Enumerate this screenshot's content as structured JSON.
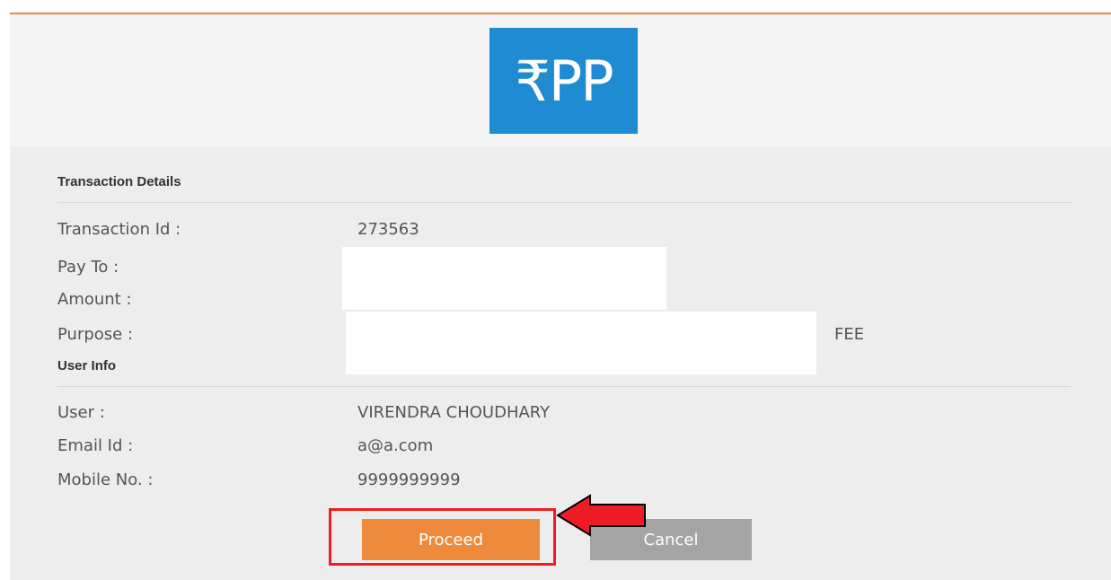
{
  "logo": {
    "text": "₹PP"
  },
  "transaction": {
    "title": "Transaction Details",
    "fields": [
      {
        "label": "Transaction Id :",
        "value": "273563"
      },
      {
        "label": "Pay To :",
        "value": ""
      },
      {
        "label": "Amount :",
        "value": ""
      },
      {
        "label": "Purpose :",
        "value": "FEE"
      }
    ]
  },
  "user_info": {
    "title": "User Info",
    "fields": [
      {
        "label": "User :",
        "value": "VIRENDRA CHOUDHARY"
      },
      {
        "label": "Email Id :",
        "value": "a@a.com"
      },
      {
        "label": "Mobile No. :",
        "value": "9999999999"
      }
    ]
  },
  "actions": {
    "proceed_label": "Proceed",
    "cancel_label": "Cancel"
  },
  "colors": {
    "accent": "#ee8a3c",
    "logo_bg": "#1e8bd2",
    "highlight": "#ee1c24",
    "cancel_bg": "#a4a4a4"
  }
}
